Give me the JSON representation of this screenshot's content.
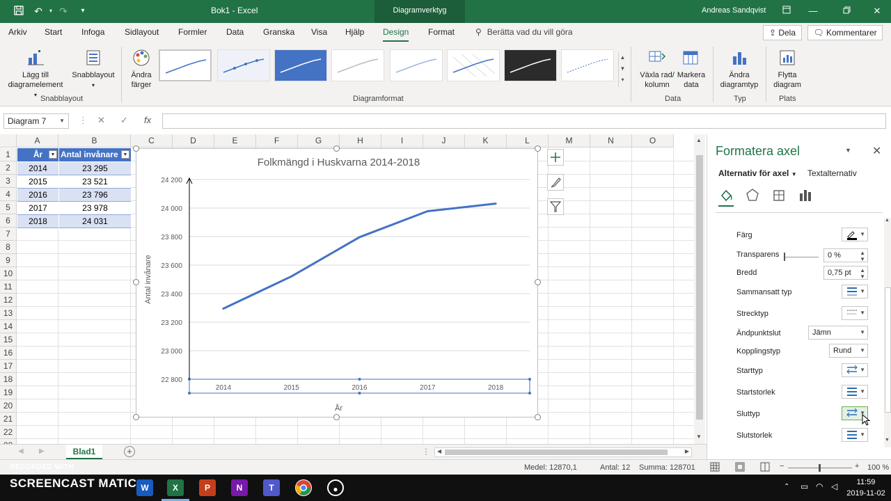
{
  "titlebar": {
    "title": "Bok1  -  Excel",
    "context_tab": "Diagramverktyg",
    "user": "Andreas Sandqvist"
  },
  "tabs": [
    "Arkiv",
    "Start",
    "Infoga",
    "Sidlayout",
    "Formler",
    "Data",
    "Granska",
    "Visa",
    "Hjälp",
    "Design",
    "Format"
  ],
  "active_tab": "Design",
  "tell_me": "Berätta vad du vill göra",
  "share_label": "Dela",
  "comments_label": "Kommentarer",
  "ribbon": {
    "add_element": "Lägg till diagramelement",
    "quick_layout": "Snabblayout",
    "quick_layout_group": "Snabblayout",
    "change_colors": "Ändra färger",
    "chart_styles_group": "Diagramformat",
    "switch_row_col": "Växla rad/ kolumn",
    "select_data": "Markera data",
    "data_group": "Data",
    "change_type": "Ändra diagramtyp",
    "type_group": "Typ",
    "move_chart": "Flytta diagram",
    "location_group": "Plats"
  },
  "namebox": "Diagram 7",
  "columns": [
    "A",
    "B",
    "C",
    "D",
    "E",
    "F",
    "G",
    "H",
    "I",
    "J",
    "K",
    "L",
    "M",
    "N",
    "O"
  ],
  "rows": [
    "1",
    "2",
    "3",
    "4",
    "5",
    "6",
    "7",
    "8",
    "9",
    "10",
    "11",
    "12",
    "13",
    "14",
    "15",
    "16",
    "17",
    "18",
    "19",
    "20",
    "21",
    "22",
    "23"
  ],
  "table": {
    "headers": [
      "År",
      "Antal invånare"
    ],
    "rows": [
      [
        "2014",
        "23 295"
      ],
      [
        "2015",
        "23 521"
      ],
      [
        "2016",
        "23 796"
      ],
      [
        "2017",
        "23 978"
      ],
      [
        "2018",
        "24 031"
      ]
    ]
  },
  "chart_data": {
    "type": "line",
    "title": "Folkmängd i Huskvarna 2014-2018",
    "xlabel": "År",
    "ylabel": "Antal invånare",
    "categories": [
      "2014",
      "2015",
      "2016",
      "2017",
      "2018"
    ],
    "values": [
      23295,
      23521,
      23796,
      23978,
      24031
    ],
    "ylim": [
      22800,
      24200
    ],
    "yticks": [
      "22 800",
      "23 000",
      "23 200",
      "23 400",
      "23 600",
      "23 800",
      "24 000",
      "24 200"
    ],
    "grid": true,
    "line_color": "#4472c4"
  },
  "sheet_tab": "Blad1",
  "pane": {
    "title": "Formatera axel",
    "tab_axis_options": "Alternativ för axel",
    "tab_text_options": "Textalternativ",
    "color_label": "Färg",
    "transparency_label": "Transparens",
    "transparency_value": "0 %",
    "width_label": "Bredd",
    "width_value": "0,75 pt",
    "compound_label": "Sammansatt typ",
    "dash_label": "Strecktyp",
    "cap_label": "Ändpunktslut",
    "cap_value": "Jämn",
    "join_label": "Kopplingstyp",
    "join_value": "Rund",
    "begin_type_label": "Starttyp",
    "begin_size_label": "Startstorlek",
    "end_type_label": "Sluttyp",
    "end_size_label": "Slutstorlek"
  },
  "status": {
    "average": "Medel: 12870,1",
    "count": "Antal: 12",
    "sum": "Summa: 128701",
    "zoom": "100 %"
  },
  "taskbar": {
    "time": "11:59",
    "date": "2019-11-02",
    "watermark_top": "RECORDED WITH",
    "watermark_brand": "SCREENCAST MATIC"
  }
}
